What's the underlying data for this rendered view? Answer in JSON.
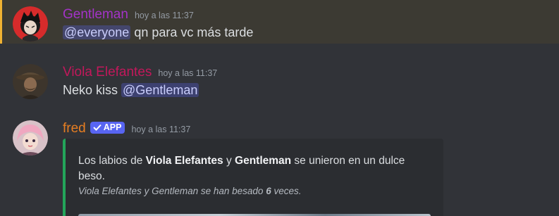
{
  "messages": [
    {
      "author": "Gentleman",
      "author_color": "#a333c8",
      "timestamp": "hoy a las 11:37",
      "mention": "@everyone",
      "text": " qn para vc más tarde"
    },
    {
      "author": "Viola Elefantes",
      "author_color": "#c2185b",
      "timestamp": "hoy a las 11:37",
      "text": "Neko kiss ",
      "mention": "@Gentleman"
    },
    {
      "author": "fred",
      "author_color": "#e67e22",
      "badge": "APP",
      "timestamp": "hoy a las 11:37",
      "embed": {
        "desc_pre": "Los labios de ",
        "name1": "Viola Elefantes",
        "desc_mid": " y ",
        "name2": "Gentleman",
        "desc_post": " se unieron en un dulce beso.",
        "footer_pre": "Viola Elefantes y Gentleman se han besado ",
        "footer_count": "6",
        "footer_post": " veces.",
        "accent_color": "#23a55a"
      }
    }
  ],
  "colors": {
    "background": "#313338",
    "mention_highlight": "#f0b232",
    "badge": "#5865f2"
  }
}
